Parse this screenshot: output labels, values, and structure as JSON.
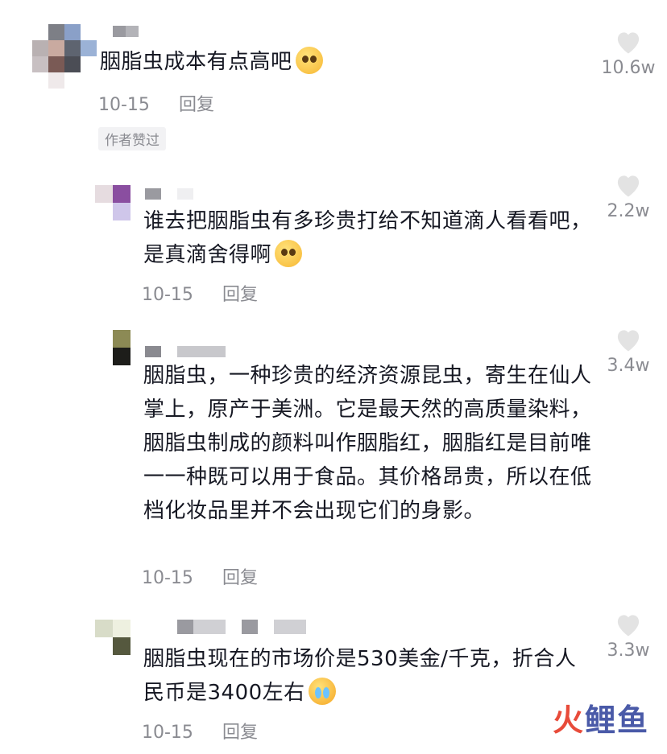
{
  "comments": [
    {
      "text": "胭脂虫成本有点高吧",
      "date": "10-15",
      "reply": "回复",
      "likes": "10.6w",
      "badge": "作者赞过",
      "emoji": "pleading-face"
    },
    {
      "text": "谁去把胭脂虫有多珍贵打给不知道滴人看看吧，是真滴舍得啊",
      "date": "10-15",
      "reply": "回复",
      "likes": "2.2w",
      "emoji": "pleading-face"
    },
    {
      "text": "胭脂虫，一种珍贵的经济资源昆虫，寄生在仙人掌上，原产于美洲。它是最天然的高质量染料，胭脂虫制成的颜料叫作胭脂红，胭脂红是目前唯一一种既可以用于食品。其价格昂贵，所以在低档化妆品里并不会出现它们的身影。",
      "date": "10-15",
      "reply": "回复",
      "likes": "3.4w"
    },
    {
      "text": "胭脂虫现在的市场价是530美金/千克，折合人民币是3400左右",
      "date": "10-15",
      "reply": "回复",
      "likes": "3.3w",
      "emoji": "crying-laughing-face"
    }
  ],
  "watermark": {
    "part1": "火",
    "part2": "鲤鱼"
  },
  "colors": {
    "text": "#161823",
    "meta": "#8a8b91",
    "heart": "#e3e3e3",
    "badge_bg": "#f2f2f4"
  },
  "icons": {
    "like": "heart-icon"
  }
}
